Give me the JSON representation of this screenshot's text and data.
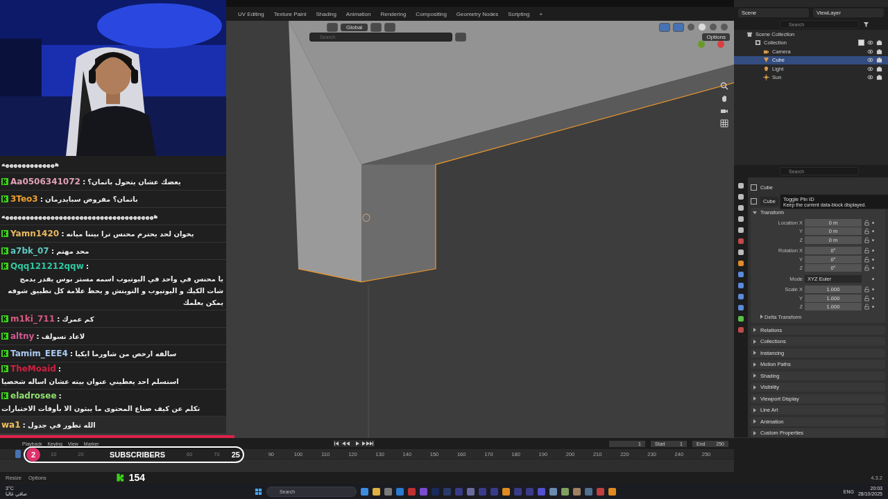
{
  "workspace_tabs": [
    {
      "label": "UV Editing",
      "selected": false
    },
    {
      "label": "Texture Paint",
      "selected": false
    },
    {
      "label": "Shading",
      "selected": false
    },
    {
      "label": "Animation",
      "selected": false
    },
    {
      "label": "Rendering",
      "selected": false
    },
    {
      "label": "Compositing",
      "selected": false
    },
    {
      "label": "Geometry Nodes",
      "selected": false
    },
    {
      "label": "Scripting",
      "selected": false
    }
  ],
  "add_tab": "+",
  "viewport": {
    "orientation": "Global",
    "search_placeholder": "Search",
    "options": "Options"
  },
  "chat": [
    {
      "kind": "plain",
      "text": "هههههههههههههه"
    },
    {
      "kind": "message",
      "user": "Aa0506341072",
      "separator": ":",
      "color": "#e0a0b8",
      "text": "يعضك عشان يتحول باتمان؟"
    },
    {
      "kind": "message",
      "user": "3Teo3",
      "separator": ":",
      "color": "#f0a030",
      "text": "باتمان؟ مفروض سبايدرمان"
    },
    {
      "kind": "plain",
      "text": "هههههههههههههههههههههههههههههههههههههه"
    },
    {
      "kind": "message",
      "user": "Yamn1420",
      "separator": ":",
      "color": "#e8b860",
      "text": "يخوان لحد يحترم محنس ترا بيننا ميانه"
    },
    {
      "kind": "message",
      "user": "a7bk_07",
      "separator": ":",
      "color": "#5ec8c0",
      "text": "محد مهتم"
    },
    {
      "kind": "message",
      "user": "Qqq121212qqw",
      "separator": ":",
      "color": "#30c8a0",
      "text": "يا محنس في واحد في اليوتيوب اسمه مستر بوس يقدر يدمج شات الكيك و اليوتيوب و التويتش و يحط علامة كل تطبيق شوفه يمكن يعلمك"
    },
    {
      "kind": "message",
      "user": "m1ki_711",
      "separator": ":",
      "color": "#d85a80",
      "text": "كم عمرك"
    },
    {
      "kind": "message",
      "user": "altny",
      "separator": ":",
      "color": "#d05a90",
      "text": "لاعاد تسولف"
    },
    {
      "kind": "message",
      "user": "Tamim_EEE4",
      "separator": ":",
      "color": "#a8c8f0",
      "text": "سالفه ارخص من شاورما ايكيا"
    },
    {
      "kind": "message",
      "user": "TheMoaid",
      "separator": ":",
      "color": "#d02040",
      "text": "استسلم احد يعطيني عنوان بيته عشان اساله شخصيا"
    },
    {
      "kind": "message",
      "user": "eladrosee",
      "separator": ":",
      "color": "#90e070",
      "text": "تكلم عن كيف صناع المحتوى ما يبثون الا بأوقات الاختبارات"
    },
    {
      "kind": "cut",
      "user": "wa1",
      "separator": ":",
      "color": "#f0c060",
      "text": "الله تطور في جدول"
    }
  ],
  "outliner": {
    "scene": "Scene",
    "view_layer": "ViewLayer",
    "search_placeholder": "Search",
    "tree": [
      {
        "label": "Scene Collection",
        "kind": "scene",
        "selected": false,
        "children": [
          {
            "label": "Collection",
            "kind": "collection",
            "selected": false,
            "checked": true,
            "children": [
              {
                "label": "Camera",
                "kind": "camera",
                "selected": false
              },
              {
                "label": "Cube",
                "kind": "mesh",
                "selected": true
              },
              {
                "label": "Light",
                "kind": "light",
                "selected": false
              },
              {
                "label": "Sun",
                "kind": "sun",
                "selected": false
              }
            ]
          }
        ]
      }
    ]
  },
  "properties": {
    "search_placeholder": "Search",
    "object_name": "Cube",
    "data_block": "Cube",
    "tooltip": {
      "title": "Toggle Pin ID",
      "text": "Keep the current data-block displayed."
    },
    "transform": {
      "title": "Transform",
      "expanded": true,
      "rows": [
        {
          "kind": "number",
          "label": "Location X",
          "value": "0 m"
        },
        {
          "kind": "number",
          "label": "Y",
          "value": "0 m"
        },
        {
          "kind": "number",
          "label": "Z",
          "value": "0 m"
        },
        {
          "kind": "number",
          "label": "Rotation X",
          "value": "0°"
        },
        {
          "kind": "number",
          "label": "Y",
          "value": "0°"
        },
        {
          "kind": "number",
          "label": "Z",
          "value": "0°"
        },
        {
          "kind": "dropdown",
          "label": "Mode",
          "value": "XYZ Euler"
        },
        {
          "kind": "number",
          "label": "Scale X",
          "value": "1.000"
        },
        {
          "kind": "number",
          "label": "Y",
          "value": "1.000"
        },
        {
          "kind": "number",
          "label": "Z",
          "value": "1.000"
        }
      ],
      "subpanel": "Delta Transform"
    },
    "panels": [
      {
        "title": "Relations",
        "expanded": false
      },
      {
        "title": "Collections",
        "expanded": false
      },
      {
        "title": "Instancing",
        "expanded": false
      },
      {
        "title": "Motion Paths",
        "expanded": false
      },
      {
        "title": "Shading",
        "expanded": false
      },
      {
        "title": "Visibility",
        "expanded": false
      },
      {
        "title": "Viewport Display",
        "expanded": false
      },
      {
        "title": "Line Art",
        "expanded": false
      },
      {
        "title": "Animation",
        "expanded": false
      },
      {
        "title": "Custom Properties",
        "expanded": false
      }
    ]
  },
  "timeline": {
    "menus": [
      "Playback",
      "Keying",
      "View",
      "Marker"
    ],
    "current_frame": "1",
    "start_label": "Start",
    "start": "1",
    "end_label": "End",
    "end": "250",
    "ruler": [
      "10",
      "20",
      "60",
      "70",
      "90",
      "100",
      "110",
      "120",
      "130",
      "140",
      "150",
      "160",
      "170",
      "180",
      "190",
      "200",
      "210",
      "220",
      "230",
      "240",
      "250"
    ]
  },
  "subscribers": {
    "count": "2",
    "label": "SUBSCRIBERS",
    "goal": "25"
  },
  "status_bar": {
    "items": [
      "Resize",
      "Options"
    ],
    "viewers": "154",
    "version": "4.3.2"
  },
  "taskbar": {
    "temperature": "3°C",
    "weather": "صافي غالبا",
    "search_placeholder": "Search",
    "language": "ENG",
    "time": "20:03",
    "date": "28/10/2025"
  }
}
